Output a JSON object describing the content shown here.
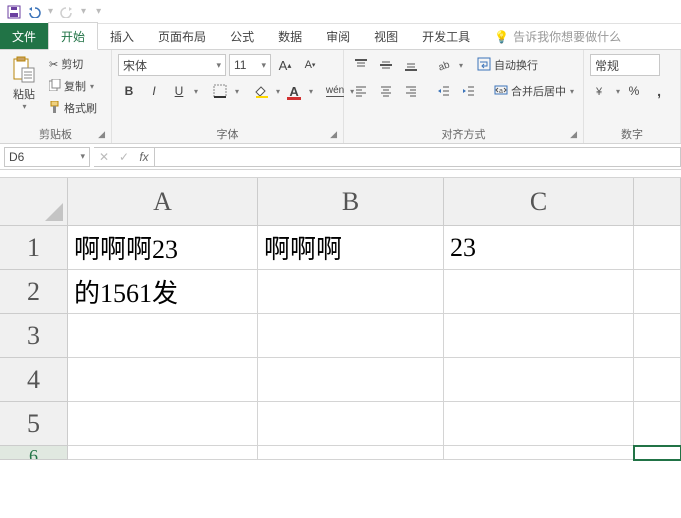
{
  "qat": {
    "save": "save",
    "undo": "undo",
    "redo": "redo"
  },
  "tabs": {
    "file": "文件",
    "home": "开始",
    "insert": "插入",
    "layout": "页面布局",
    "formulas": "公式",
    "data": "数据",
    "review": "审阅",
    "view": "视图",
    "dev": "开发工具",
    "tell": "告诉我你想要做什么"
  },
  "ribbon": {
    "clipboard": {
      "label": "剪贴板",
      "paste": "粘贴",
      "cut": "剪切",
      "copy": "复制",
      "format": "格式刷"
    },
    "font": {
      "label": "字体",
      "name": "宋体",
      "size": "11",
      "bold": "B",
      "italic": "I",
      "underline": "U"
    },
    "align": {
      "label": "对齐方式",
      "wrap": "自动换行",
      "merge": "合并后居中"
    },
    "number": {
      "label": "数字",
      "format": "常规",
      "percent": "%",
      "comma": ","
    }
  },
  "formula_bar": {
    "namebox": "D6",
    "fx": "fx",
    "value": ""
  },
  "grid": {
    "cols": [
      "A",
      "B",
      "C"
    ],
    "rows": [
      "1",
      "2",
      "3",
      "4",
      "5",
      "6"
    ],
    "cells": {
      "A1": "啊啊啊23",
      "B1": "啊啊啊",
      "C1": "23",
      "A2": "的1561发"
    },
    "selected": "D6"
  }
}
